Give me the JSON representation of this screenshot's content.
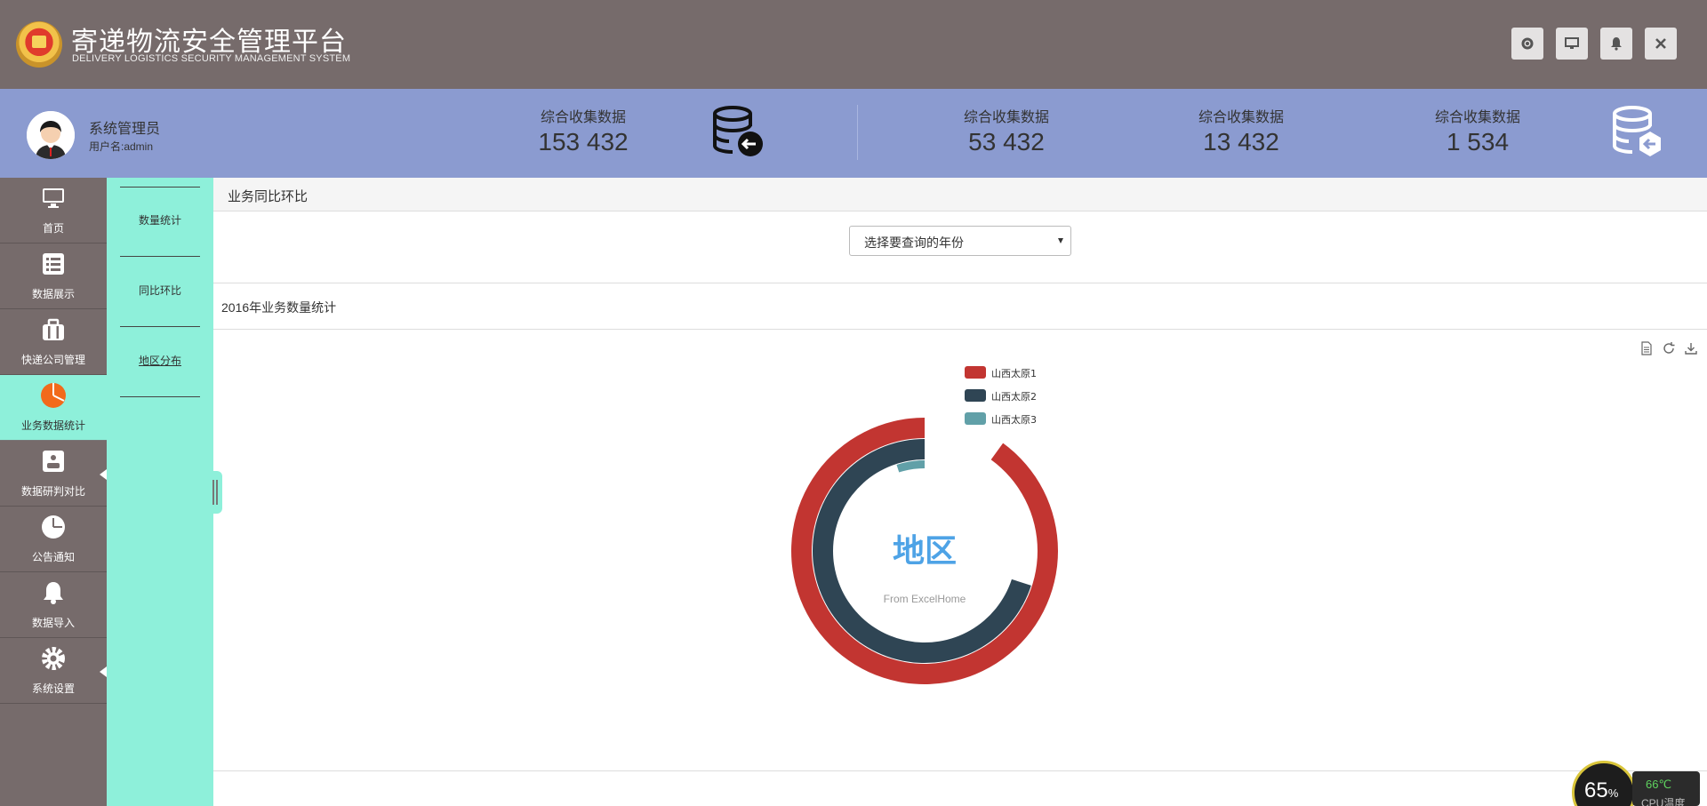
{
  "app": {
    "title": "寄递物流安全管理平台",
    "subtitle": "DELIVERY LOGISTICS SECURITY MANAGEMENT SYSTEM"
  },
  "toolbar": {
    "icons": [
      "gear-icon",
      "monitor-icon",
      "bell-icon",
      "close-icon"
    ]
  },
  "user": {
    "name": "系统管理员",
    "login": "用户名:admin"
  },
  "stats": [
    {
      "label": "综合收集数据",
      "value": "153 432"
    },
    {
      "label": "综合收集数据",
      "value": "53 432"
    },
    {
      "label": "综合收集数据",
      "value": "13 432"
    },
    {
      "label": "综合收集数据",
      "value": "1 534"
    }
  ],
  "nav": {
    "items": [
      {
        "label": "首页",
        "icon": "monitor-icon"
      },
      {
        "label": "数据展示",
        "icon": "list-icon"
      },
      {
        "label": "快递公司管理",
        "icon": "briefcase-icon"
      },
      {
        "label": "业务数据统计",
        "icon": "pie-chart-icon"
      },
      {
        "label": "数据研判对比",
        "icon": "compare-icon"
      },
      {
        "label": "公告通知",
        "icon": "clock-icon"
      },
      {
        "label": "数据导入",
        "icon": "bell-icon"
      },
      {
        "label": "系统设置",
        "icon": "gear-icon"
      }
    ]
  },
  "subnav": {
    "items": [
      {
        "label": "数量统计"
      },
      {
        "label": "同比环比"
      },
      {
        "label": "地区分布"
      }
    ]
  },
  "main": {
    "breadcrumb": "业务同比环比",
    "year_select_placeholder": "选择要查询的年份",
    "section_title": "2016年业务数量统计"
  },
  "chart_data": {
    "type": "pie",
    "title": "地区",
    "subtitle": "From ExcelHome",
    "series": [
      {
        "name": "山西太原1",
        "value": 0.9,
        "color": "#c23531"
      },
      {
        "name": "山西太原2",
        "value": 0.7,
        "color": "#2f4554"
      },
      {
        "name": "山西太原3",
        "value": 0.05,
        "color": "#61a0a8"
      }
    ],
    "legend_position": "top-right"
  },
  "cpu": {
    "percent": "65",
    "unit": "%",
    "temp": "66℃",
    "label": "CPU温度"
  }
}
